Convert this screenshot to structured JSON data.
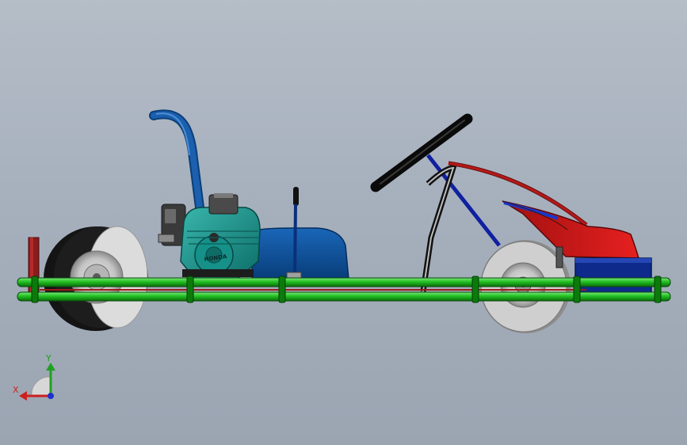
{
  "model": {
    "engine_brand": "HONDA"
  },
  "triad": {
    "x_label": "X",
    "y_label": "Y",
    "x_color": "#cc2020",
    "y_color": "#20a020",
    "z_color": "#2030cc"
  },
  "colors": {
    "background": "#a6b0bd",
    "frame_tube": "#1fb81f",
    "engine_body": "#1a8f88",
    "seat": "#0b4f99",
    "steering": "#1a1a1a",
    "fuel_pipe": "#1b5fae",
    "nose_fairing": "#d81818",
    "bumper_block": "#0f2a8f",
    "wheel_rim": "#c9c9c9",
    "tire": "#151515"
  }
}
